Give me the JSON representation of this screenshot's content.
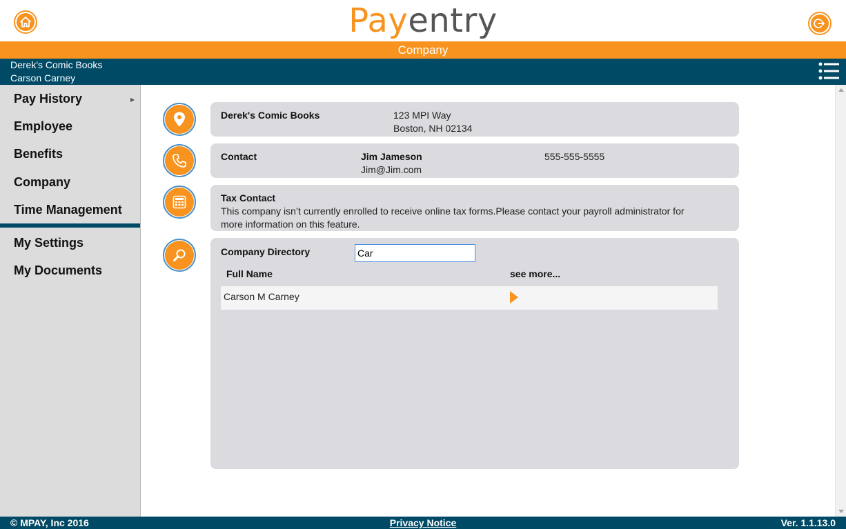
{
  "header": {
    "logo_pay": "Pay",
    "logo_entry": "entry",
    "section_title": "Company",
    "company_name": "Derek's Comic Books",
    "user_name": "Carson Carney"
  },
  "sidebar": {
    "items": [
      {
        "label": "Pay History"
      },
      {
        "label": "Employee"
      },
      {
        "label": "Benefits"
      },
      {
        "label": "Company"
      },
      {
        "label": "Time Management"
      },
      {
        "label": "My Settings"
      },
      {
        "label": "My Documents"
      }
    ]
  },
  "company_card": {
    "name": "Derek's Comic Books",
    "address_line1": "123 MPI Way",
    "address_line2": "Boston, NH 02134"
  },
  "contact_card": {
    "label": "Contact",
    "name": "Jim Jameson",
    "email": "Jim@Jim.com",
    "phone": "555-555-5555"
  },
  "tax_card": {
    "label": "Tax Contact",
    "message_line1": "This company isn’t currently enrolled to receive online tax forms.Please contact your payroll administrator for",
    "message_line2": "more information on this feature."
  },
  "directory": {
    "label": "Company Directory",
    "search_value": "Car",
    "col_full_name": "Full Name",
    "col_see_more": "see more...",
    "rows": [
      {
        "full_name": "Carson M Carney"
      }
    ]
  },
  "footer": {
    "copyright": "© MPAY, Inc 2016",
    "privacy": "Privacy Notice",
    "version": "Ver. 1.1.13.0"
  },
  "colors": {
    "accent": "#f7931e",
    "navy": "#004a66",
    "card_bg": "#dadadf",
    "sidebar_bg": "#dcdcdc"
  }
}
